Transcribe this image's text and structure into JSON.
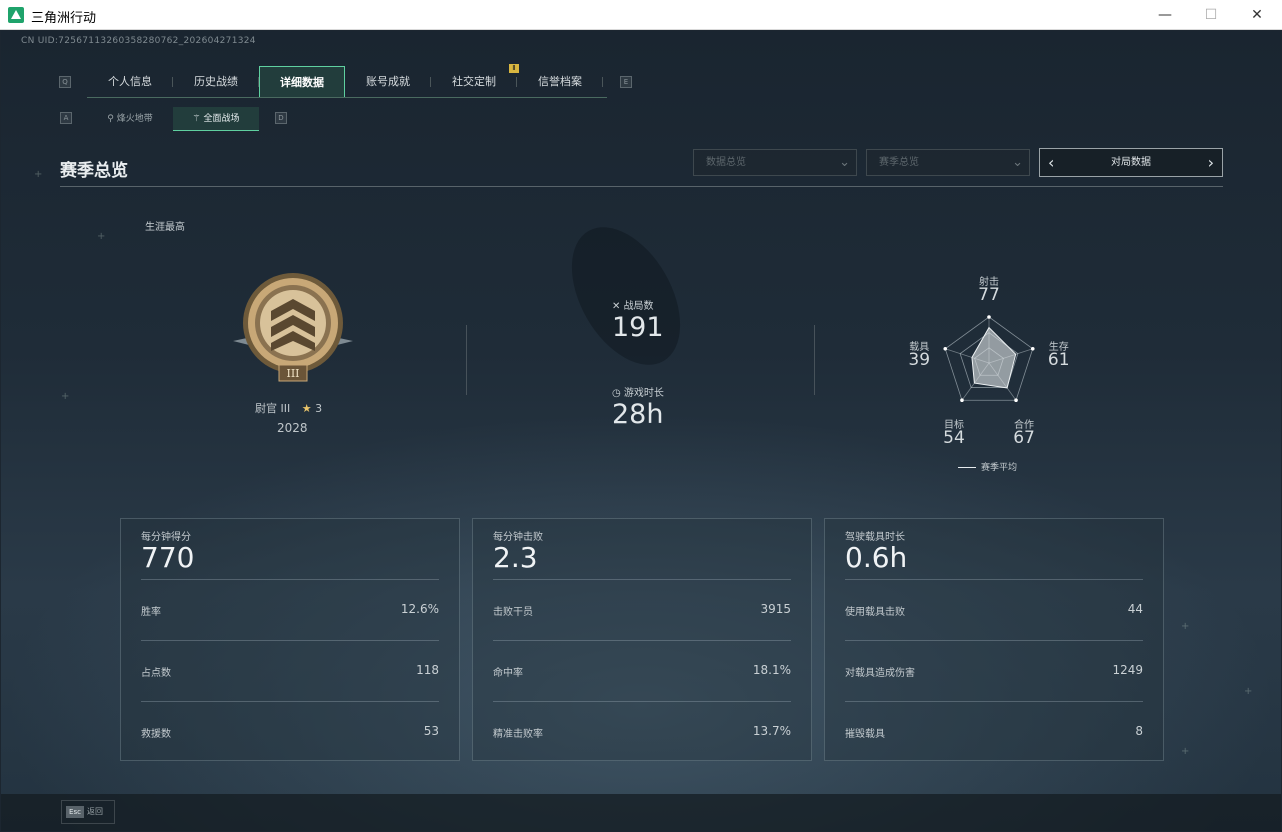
{
  "window": {
    "title": "三角洲行动",
    "minimize_glyph": "—",
    "maximize_glyph": "☐",
    "close_glyph": "✕"
  },
  "uid": "CN UID:7256711326035828076​2_202604271324",
  "key_hints": {
    "left_tab": "Q",
    "right_tab": "E",
    "left_sub": "A",
    "right_sub": "D"
  },
  "main_tabs": [
    {
      "label": "个人信息",
      "active": false
    },
    {
      "label": "历史战绩",
      "active": false
    },
    {
      "label": "详细数据",
      "active": true
    },
    {
      "label": "账号成就",
      "active": false
    },
    {
      "label": "社交定制",
      "active": false,
      "badge": true
    },
    {
      "label": "信誉档案",
      "active": false
    }
  ],
  "sub_tabs": [
    {
      "label": "烽火地带",
      "icon": "flame-icon",
      "active": false
    },
    {
      "label": "全面战场",
      "icon": "crosshair-icon",
      "active": true
    }
  ],
  "section_title": "赛季总览",
  "filters": {
    "data_overview": "数据总览",
    "season_overview": "赛季总览",
    "match_data": "对局数据",
    "prev_arrow": "‹",
    "next_arrow": "›",
    "chevron": "⌄"
  },
  "career": {
    "label": "生涯最高",
    "rank_name": "尉官 III",
    "stars": "3",
    "score": "2028",
    "star_glyph": "★"
  },
  "summary": {
    "matches_label": "战局数",
    "matches_value": "191",
    "playtime_label": "游戏时长",
    "playtime_value": "28h"
  },
  "radar": {
    "axes": [
      {
        "label": "射击",
        "value": 77
      },
      {
        "label": "生存",
        "value": 61
      },
      {
        "label": "合作",
        "value": 67
      },
      {
        "label": "目标",
        "value": 54
      },
      {
        "label": "载具",
        "value": 39
      }
    ],
    "max": 100,
    "legend": "赛季平均"
  },
  "cards": [
    {
      "head": "每分钟得分",
      "big": "770",
      "rows": [
        {
          "k": "胜率",
          "v": "12.6%"
        },
        {
          "k": "占点数",
          "v": "118"
        },
        {
          "k": "救援数",
          "v": "53"
        }
      ]
    },
    {
      "head": "每分钟击败",
      "big": "2.3",
      "rows": [
        {
          "k": "击败干员",
          "v": "3915"
        },
        {
          "k": "命中率",
          "v": "18.1%"
        },
        {
          "k": "精准击败率",
          "v": "13.7%"
        }
      ]
    },
    {
      "head": "驾驶载具时长",
      "big": "0.6h",
      "rows": [
        {
          "k": "使用载具击败",
          "v": "44"
        },
        {
          "k": "对载具造成伤害",
          "v": "1249"
        },
        {
          "k": "摧毁载具",
          "v": "8"
        }
      ]
    }
  ],
  "footer": {
    "esc_key": "Esc",
    "esc_label": "返回"
  },
  "colors": {
    "accent": "#5fd0a0",
    "badge": "#d8b640",
    "background": "#1f2c38"
  }
}
